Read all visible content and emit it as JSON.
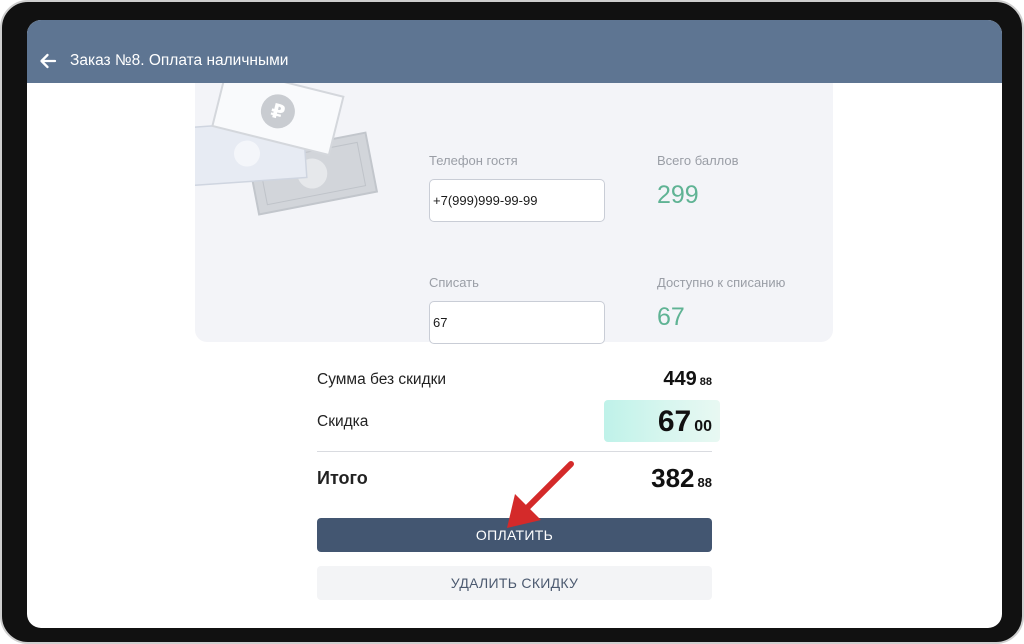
{
  "header": {
    "title": "Заказ №8. Оплата наличными",
    "back_icon": "arrow-left-icon"
  },
  "loyalty": {
    "phone_label": "Телефон гостя",
    "phone_value": "+7(999)999-99-99",
    "total_points_label": "Всего баллов",
    "total_points_value": "299",
    "writeoff_label": "Списать",
    "writeoff_value": "67",
    "available_label": "Доступно к списанию",
    "available_value": "67"
  },
  "summary": {
    "subtotal_label": "Сумма без скидки",
    "subtotal_main": "449",
    "subtotal_cents": "88",
    "discount_label": "Скидка",
    "discount_main": "67",
    "discount_cents": "00",
    "total_label": "Итого",
    "total_main": "382",
    "total_cents": "88"
  },
  "actions": {
    "pay_label": "ОПЛАТИТЬ",
    "remove_discount_label": "УДАЛИТЬ СКИДКУ"
  },
  "colors": {
    "appbar": "#5e7592",
    "accent_green": "#5fb394",
    "pay_button": "#435671",
    "annotation_arrow": "#d42a2a"
  }
}
